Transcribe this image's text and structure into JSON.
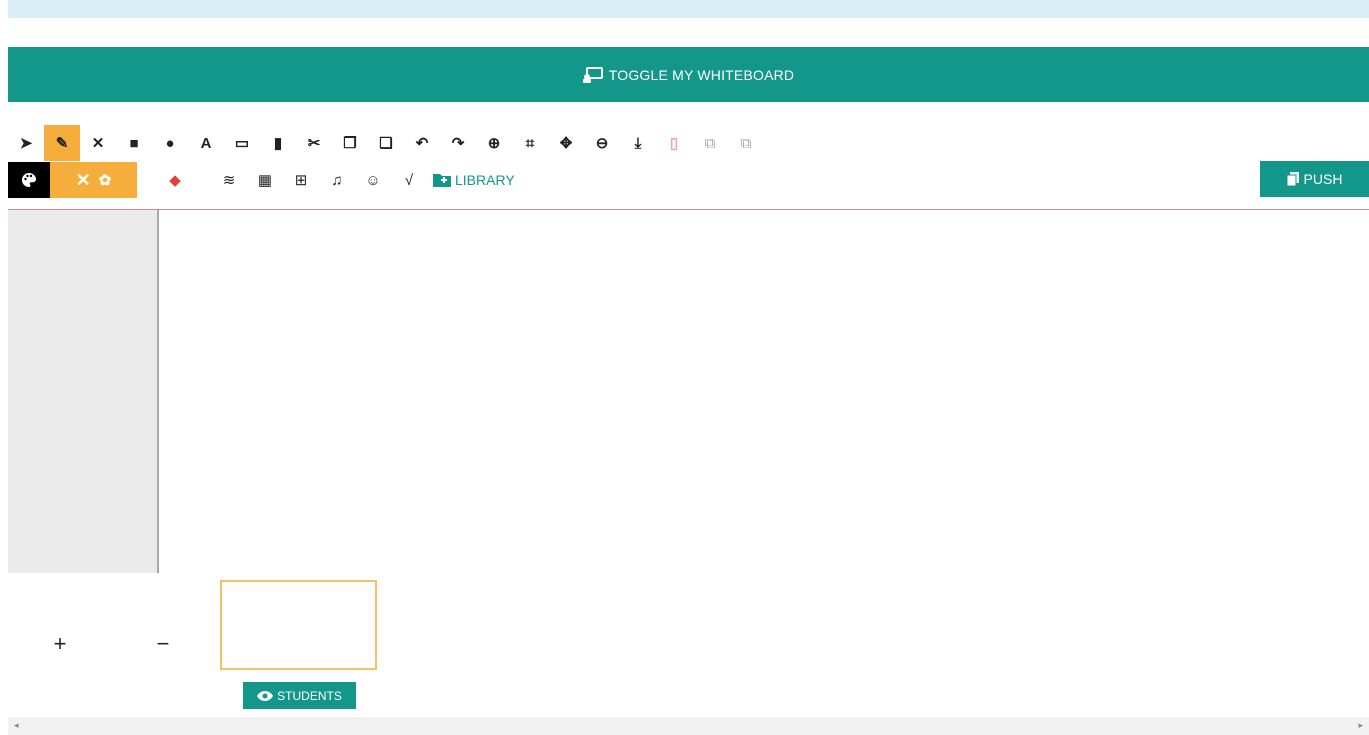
{
  "toggle": {
    "label": "TOGGLE MY WHITEBOARD",
    "icon": "chalkboard-teacher-icon"
  },
  "toolbar": {
    "row1": [
      {
        "name": "select-tool",
        "icon": "mouse-pointer-icon",
        "glyph": "➤",
        "active": false
      },
      {
        "name": "pen-tool",
        "icon": "pencil-icon",
        "glyph": "✎",
        "active": true
      },
      {
        "name": "line-tool",
        "icon": "cross-tools-icon",
        "glyph": "✕",
        "active": false
      },
      {
        "name": "rectangle-tool",
        "icon": "square-icon",
        "glyph": "■",
        "active": false
      },
      {
        "name": "circle-tool",
        "icon": "circle-icon",
        "glyph": "●",
        "active": false
      },
      {
        "name": "text-tool",
        "icon": "text-icon",
        "glyph": "A",
        "active": false
      },
      {
        "name": "image-tool",
        "icon": "image-icon",
        "glyph": "▭",
        "active": false
      },
      {
        "name": "document-tool",
        "icon": "file-icon",
        "glyph": "▮",
        "active": false
      },
      {
        "name": "cut-tool",
        "icon": "scissors-icon",
        "glyph": "✂",
        "active": false
      },
      {
        "name": "copy-tool",
        "icon": "copy-icon",
        "glyph": "❐",
        "active": false
      },
      {
        "name": "paste-tool",
        "icon": "paste-icon",
        "glyph": "❏",
        "active": false
      },
      {
        "name": "undo-tool",
        "icon": "undo-icon",
        "glyph": "↶",
        "active": false
      },
      {
        "name": "redo-tool",
        "icon": "redo-icon",
        "glyph": "↷",
        "active": false
      },
      {
        "name": "zoom-in-tool",
        "icon": "zoom-in-icon",
        "glyph": "⊕",
        "active": false
      },
      {
        "name": "fit-tool",
        "icon": "compress-icon",
        "glyph": "⌗",
        "active": false
      },
      {
        "name": "pan-tool",
        "icon": "move-icon",
        "glyph": "✥",
        "active": false
      },
      {
        "name": "zoom-out-tool",
        "icon": "zoom-out-icon",
        "glyph": "⊖",
        "active": false
      },
      {
        "name": "download-tool",
        "icon": "download-icon",
        "glyph": "⤓",
        "active": false
      },
      {
        "name": "delete-tool",
        "icon": "trash-icon",
        "glyph": "▯",
        "active": false,
        "style": "pink"
      },
      {
        "name": "bring-front-tool",
        "icon": "layer-front-icon",
        "glyph": "⧉",
        "active": false,
        "style": "light"
      },
      {
        "name": "send-back-tool",
        "icon": "layer-back-icon",
        "glyph": "⧉",
        "active": false,
        "style": "light"
      }
    ],
    "row2": [
      {
        "name": "eraser-tool",
        "icon": "eraser-icon",
        "glyph": "◆",
        "color": "#e0413b"
      },
      {
        "name": "layers-tool",
        "icon": "layers-icon",
        "glyph": "≋",
        "color": "#222"
      },
      {
        "name": "grid-tool",
        "icon": "grid-icon",
        "glyph": "▦",
        "color": "#222"
      },
      {
        "name": "table-tool",
        "icon": "table-icon",
        "glyph": "⊞",
        "color": "#222"
      },
      {
        "name": "music-tool",
        "icon": "music-icon",
        "glyph": "♫",
        "color": "#222"
      },
      {
        "name": "emoji-tool",
        "icon": "smile-icon",
        "glyph": "☺",
        "color": "#222"
      },
      {
        "name": "math-tool",
        "icon": "square-root-icon",
        "glyph": "√",
        "color": "#222"
      }
    ],
    "library_label": "LIBRARY"
  },
  "push": {
    "label": "PUSH"
  },
  "zoom": {
    "plus": "+",
    "minus": "−"
  },
  "students": {
    "label": "STUDENTS"
  },
  "colors": {
    "accent": "#13978a",
    "active": "#f5ad3b",
    "banner": "#d9edf7"
  }
}
